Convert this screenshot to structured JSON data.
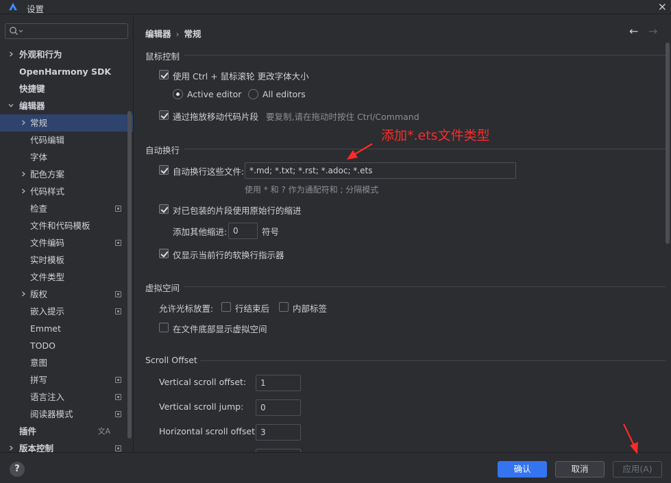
{
  "window": {
    "title": "设置",
    "close_glyph": "×"
  },
  "sidebar": {
    "search": {
      "placeholder": "",
      "icon": "search-icon"
    },
    "items": [
      {
        "label": "外观和行为",
        "level": 0,
        "expandable": true,
        "expanded": false
      },
      {
        "label": "OpenHarmony SDK",
        "level": 0,
        "expandable": false
      },
      {
        "label": "快捷键",
        "level": 0,
        "expandable": false
      },
      {
        "label": "编辑器",
        "level": 0,
        "expandable": true,
        "expanded": true
      },
      {
        "label": "常规",
        "level": 1,
        "expandable": true,
        "expanded": false,
        "selected": true
      },
      {
        "label": "代码编辑",
        "level": 1
      },
      {
        "label": "字体",
        "level": 1
      },
      {
        "label": "配色方案",
        "level": 1,
        "expandable": true
      },
      {
        "label": "代码样式",
        "level": 1,
        "expandable": true
      },
      {
        "label": "检查",
        "level": 1,
        "marker": true
      },
      {
        "label": "文件和代码模板",
        "level": 1
      },
      {
        "label": "文件编码",
        "level": 1,
        "marker": true
      },
      {
        "label": "实时模板",
        "level": 1
      },
      {
        "label": "文件类型",
        "level": 1
      },
      {
        "label": "版权",
        "level": 1,
        "expandable": true,
        "marker": true
      },
      {
        "label": "嵌入提示",
        "level": 1,
        "marker": true
      },
      {
        "label": "Emmet",
        "level": 1
      },
      {
        "label": "TODO",
        "level": 1
      },
      {
        "label": "意图",
        "level": 1
      },
      {
        "label": "拼写",
        "level": 1,
        "marker": true
      },
      {
        "label": "语言注入",
        "level": 1,
        "marker": true
      },
      {
        "label": "阅读器模式",
        "level": 1,
        "marker": true
      },
      {
        "label": "插件",
        "level": 0,
        "translate": true
      },
      {
        "label": "版本控制",
        "level": 0,
        "expandable": true,
        "marker": true
      }
    ]
  },
  "main": {
    "breadcrumb": {
      "parent": "编辑器",
      "sep": "›",
      "current": "常规"
    },
    "nav": {
      "back": "←",
      "forward": "→"
    },
    "mouse": {
      "title": "鼠标控制",
      "zoom_label": "使用 Ctrl + 鼠标滚轮 更改字体大小",
      "active_editor": "Active editor",
      "all_editors": "All editors",
      "dnd_label": "通过拖放移动代码片段",
      "dnd_hint": "要复制,请在拖动时按住 Ctrl/Command"
    },
    "softwrap": {
      "title": "自动换行",
      "files_label": "自动换行这些文件:",
      "files_value": "*.md; *.txt; *.rst; *.adoc; *.ets",
      "files_hint": "使用 * 和 ? 作为通配符和 ; 分隔模式",
      "indent_label": "对已包装的片段使用原始行的缩进",
      "extra_indent_label": "添加其他缩进:",
      "extra_indent_value": "0",
      "extra_indent_unit": "符号",
      "current_line_label": "仅显示当前行的软换行指示器"
    },
    "virtual": {
      "title": "虚拟空间",
      "caret_label": "允许光标放置:",
      "line_end": "行结束后",
      "inside_tabs": "内部标签",
      "bottom_label": "在文件底部显示虚拟空间"
    },
    "scroll": {
      "title": "Scroll Offset",
      "vertical_offset_label": "Vertical scroll offset:",
      "vertical_offset_value": "1",
      "vertical_jump_label": "Vertical scroll jump:",
      "vertical_jump_value": "0",
      "horizontal_offset_label": "Horizontal scroll offset:",
      "horizontal_offset_value": "3"
    },
    "annotation": "添加*.ets文件类型"
  },
  "footer": {
    "help": "?",
    "ok": "确认",
    "cancel": "取消",
    "apply": "应用(A)"
  },
  "colors": {
    "accent": "#3574f0",
    "annotation": "#ff2a2a",
    "selection": "#2e436e"
  }
}
